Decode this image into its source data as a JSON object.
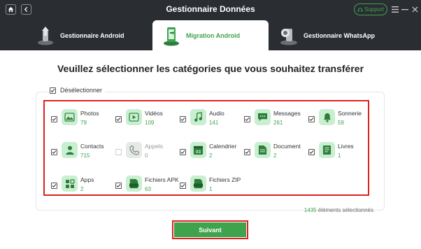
{
  "window": {
    "title": "Gestionnaire Données",
    "support_label": "Support"
  },
  "tabs": [
    {
      "label": "Gestionnaire Android",
      "icon": "android-upload-icon",
      "active": false
    },
    {
      "label": "Migration Android",
      "icon": "phone-transfer-icon",
      "active": true
    },
    {
      "label": "Gestionnaire WhatsApp",
      "icon": "whatsapp-phone-icon",
      "active": false
    }
  ],
  "main": {
    "heading": "Veuillez sélectionner les catégories que vous souhaitez transférer",
    "deselect_label": "Désélectionner",
    "selected_count": "1435",
    "selected_suffix": "éléments sélectionnés",
    "next_label": "Suivant"
  },
  "categories": [
    {
      "name": "Photos",
      "count": "79",
      "icon": "photo-icon",
      "checked": true
    },
    {
      "name": "Vidéos",
      "count": "109",
      "icon": "video-icon",
      "checked": true
    },
    {
      "name": "Audio",
      "count": "141",
      "icon": "music-icon",
      "checked": true
    },
    {
      "name": "Messages",
      "count": "261",
      "icon": "message-icon",
      "checked": true
    },
    {
      "name": "Sonnerie",
      "count": "59",
      "icon": "bell-icon",
      "checked": true
    },
    {
      "name": "Contacts",
      "count": "715",
      "icon": "contact-icon",
      "checked": true
    },
    {
      "name": "Appels",
      "count": "0",
      "icon": "phone-icon",
      "checked": false
    },
    {
      "name": "Calendrier",
      "count": "2",
      "icon": "calendar-icon",
      "checked": true
    },
    {
      "name": "Document",
      "count": "2",
      "icon": "document-icon",
      "checked": true
    },
    {
      "name": "Livres",
      "count": "1",
      "icon": "book-icon",
      "checked": true
    },
    {
      "name": "Apps",
      "count": "2",
      "icon": "apps-icon",
      "checked": true
    },
    {
      "name": "Fichiers APK",
      "count": "63",
      "icon": "apk-icon",
      "checked": true
    },
    {
      "name": "Fichiers ZIP",
      "count": "1",
      "icon": "zip-icon",
      "checked": true
    }
  ],
  "colors": {
    "accent": "#3fa34d",
    "titlebar": "#2a2d32",
    "highlight": "#e02020",
    "icon_bg": "#c8efd0"
  }
}
